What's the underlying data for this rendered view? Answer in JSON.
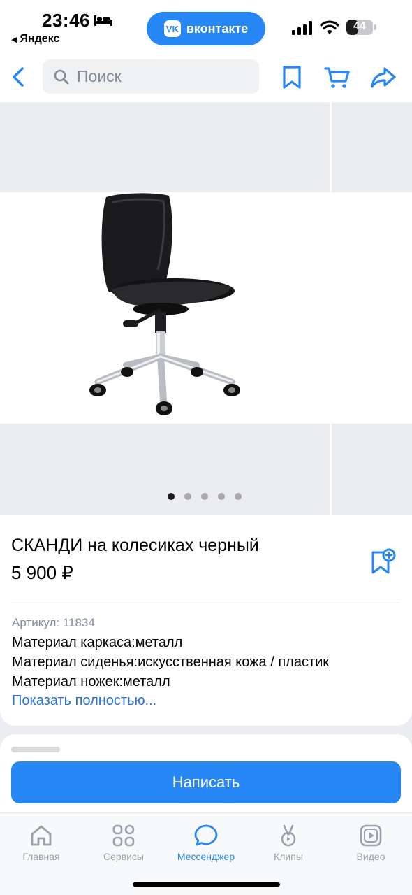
{
  "status_bar": {
    "time": "23:46",
    "back_app": "Яндекс",
    "vk_pill": "вконтакте",
    "battery": "44",
    "battery_level": 0.44
  },
  "nav": {
    "search_placeholder": "Поиск"
  },
  "gallery": {
    "image_count": 5,
    "active_index": 0
  },
  "product": {
    "title": "СКАНДИ на колесиках черный",
    "price": "5 900 ₽",
    "sku": "Артикул: 11834",
    "specs": [
      "Материал каркаса:металл",
      "Материал сиденья:искусственная кожа / пластик",
      "Материал ножек:металл"
    ],
    "show_more": "Показать полностью..."
  },
  "actions": {
    "write_button": "Написать"
  },
  "tabbar": {
    "items": [
      {
        "label": "Главная",
        "icon": "home-icon"
      },
      {
        "label": "Сервисы",
        "icon": "services-icon"
      },
      {
        "label": "Мессенджер",
        "icon": "messenger-icon"
      },
      {
        "label": "Клипы",
        "icon": "clips-icon"
      },
      {
        "label": "Видео",
        "icon": "video-icon"
      }
    ],
    "active_index": 2
  },
  "colors": {
    "accent": "#2787f5",
    "link": "#2a72d1",
    "secondary_text": "#818c99",
    "background": "#ebedf0"
  }
}
